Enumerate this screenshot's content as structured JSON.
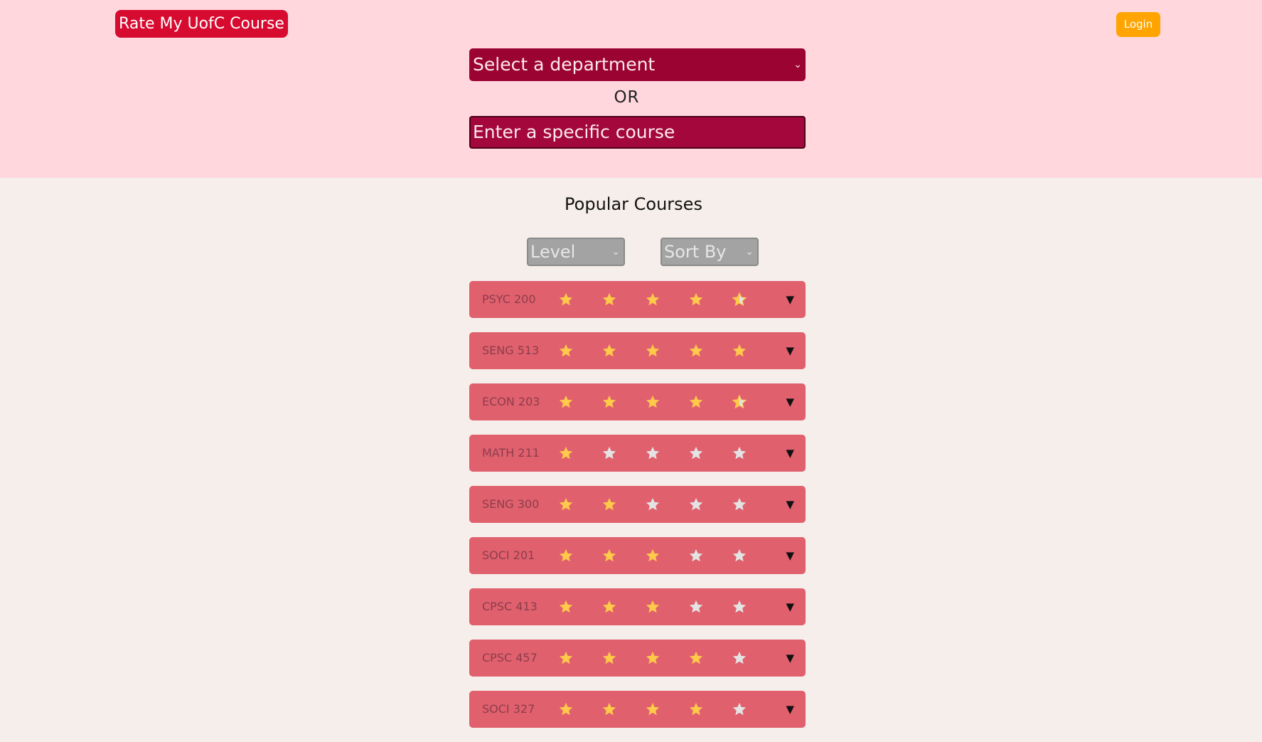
{
  "header": {
    "brand": "Rate My UofC Course",
    "login_label": "Login",
    "department_select": {
      "value": "Select a department",
      "chevron": "⌄"
    },
    "or_text": "OR",
    "course_input_placeholder": "Enter a specific course"
  },
  "main": {
    "title": "Popular Courses",
    "level_select": {
      "value": "Level",
      "chevron": "⌄"
    },
    "sort_select": {
      "value": "Sort By",
      "chevron": "⌄"
    },
    "courses": [
      {
        "code": "PSYC 200",
        "rating": 4.5
      },
      {
        "code": "SENG 513",
        "rating": 5
      },
      {
        "code": "ECON 203",
        "rating": 4.5
      },
      {
        "code": "MATH 211",
        "rating": 1
      },
      {
        "code": "SENG 300",
        "rating": 2
      },
      {
        "code": "SOCI 201",
        "rating": 3
      },
      {
        "code": "CPSC 413",
        "rating": 3
      },
      {
        "code": "CPSC 457",
        "rating": 4
      },
      {
        "code": "SOCI 327",
        "rating": 4
      }
    ],
    "expand_icon": "▼"
  },
  "colors": {
    "header_bg": "#ffd7dd",
    "page_bg": "#f6eeea",
    "brand": "#d70a2f",
    "login": "#ffa400",
    "select_bg": "#9b0333",
    "row_bg": "#e0606e",
    "star_filled": "#ffc94a",
    "star_empty": "#e3e3e3"
  }
}
